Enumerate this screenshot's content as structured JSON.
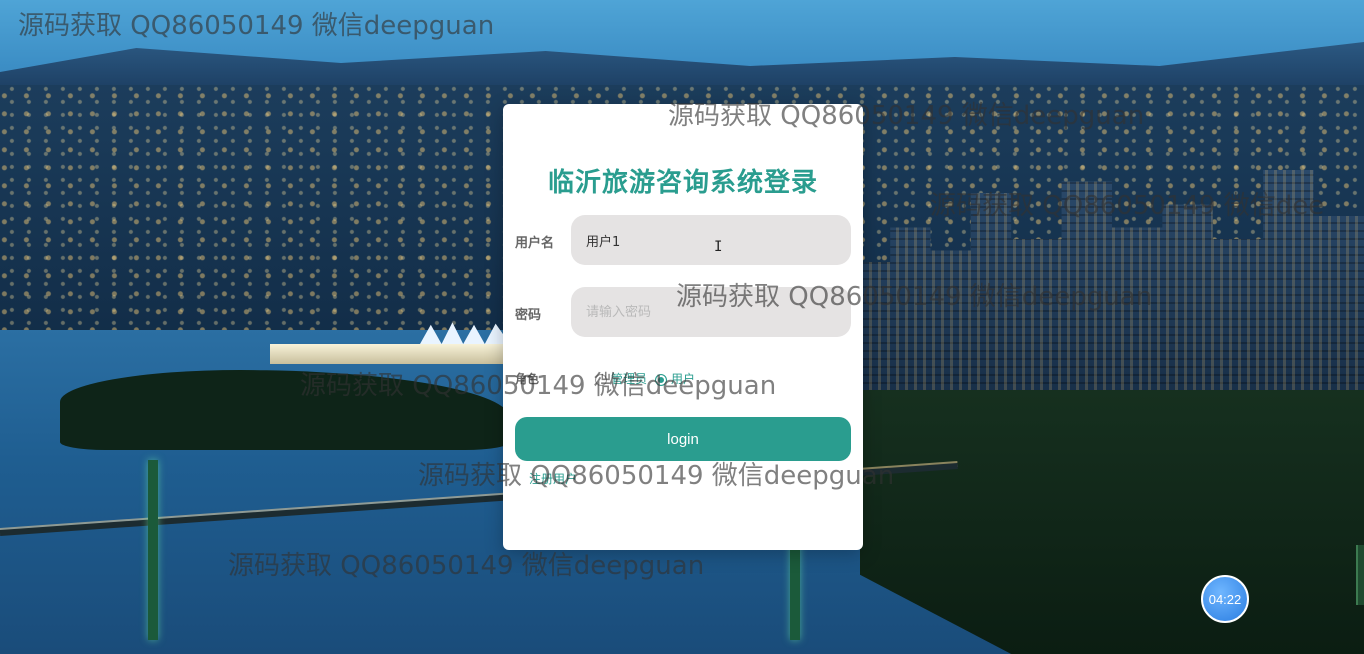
{
  "login": {
    "title": "临沂旅游咨询系统登录",
    "username_label": "用户名",
    "username_value": "用户1",
    "password_label": "密码",
    "password_placeholder": "请输入密码",
    "role_label": "角色",
    "roles": [
      {
        "label": "管理员",
        "checked": false
      },
      {
        "label": "用户",
        "checked": true
      }
    ],
    "login_button": "login",
    "register_link": "注册用户"
  },
  "watermark": {
    "text": "源码获取 QQ86050149 微信deepguan",
    "text_partial": "源码获取 QQ86050149 微信dee"
  },
  "timer": {
    "value": "04:22"
  },
  "colors": {
    "accent": "#2a9d8f",
    "input_bg": "#e5e3e3",
    "timer_bg": "#2a7de1"
  }
}
